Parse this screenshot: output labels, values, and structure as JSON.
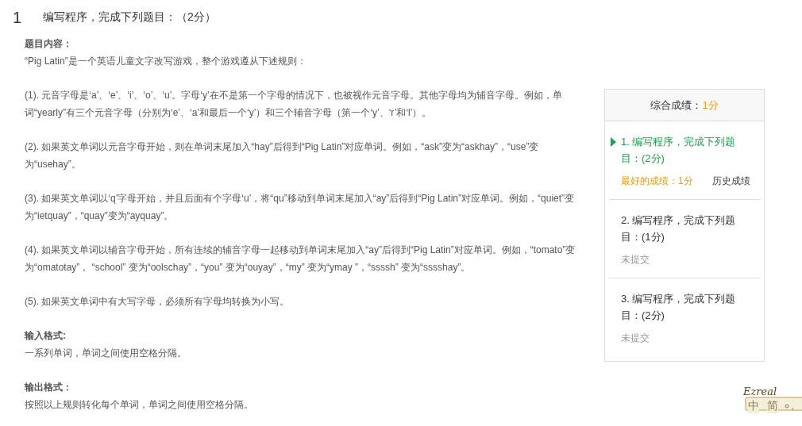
{
  "question": {
    "number": "1",
    "title": "编写程序，完成下列题目：（2分）"
  },
  "sections": [
    {
      "heading": "题目内容：",
      "paragraphs": [
        "“Pig Latin”是一个英语儿童文字改写游戏，整个游戏遵从下述规则：",
        "(1). 元音字母是‘a’、‘e’、‘i’、‘o’、‘u’。字母‘y’在不是第一个字母的情况下，也被视作元音字母。其他字母均为辅音字母。例如，单词“yearly”有三个元音字母（分别为‘e’、‘a’和最后一个‘y’）和三个辅音字母（第一个‘y’、‘r’和‘l’）。",
        "(2). 如果英文单词以元音字母开始，则在单词末尾加入“hay”后得到“Pig Latin”对应单词。例如，“ask”变为“askhay”，“use”变为“usehay”。",
        "(3). 如果英文单词以‘q’字母开始，并且后面有个字母‘u’，将“qu”移动到单词末尾加入“ay”后得到“Pig Latin”对应单词。例如，“quiet”变为“ietquay”，“quay”变为“ayquay”。",
        "(4). 如果英文单词以辅音字母开始，所有连续的辅音字母一起移动到单词末尾加入“ay”后得到“Pig Latin”对应单词。例如，“tomato”变为“omatotay”， “school” 变为“oolschay”，“you” 变为“ouyay”，“my” 变为“ymay ”，“ssssh” 变为“sssshay”。",
        "(5). 如果英文单词中有大写字母，必须所有字母均转换为小写。"
      ]
    },
    {
      "heading": "输入格式:",
      "paragraphs": [
        "一系列单词，单词之间使用空格分隔。"
      ]
    },
    {
      "heading": "输出格式：",
      "paragraphs": [
        "按照以上规则转化每个单词，单词之间使用空格分隔。"
      ]
    }
  ],
  "sidebar": {
    "total_label": "综合成绩：",
    "total_score": "1分",
    "items": [
      {
        "title": "1. 编写程序，完成下列题目：(2分)",
        "selected": true,
        "kind": "scored",
        "best_label": "最好的成绩：",
        "best_score": "1分",
        "history_link": "历史成绩"
      },
      {
        "title": "2. 编写程序，完成下列题目：(1分)",
        "selected": false,
        "kind": "unsubmitted",
        "status": "未提交"
      },
      {
        "title": "3. 编写程序，完成下列题目：(2分)",
        "selected": false,
        "kind": "unsubmitted",
        "status": "未提交"
      }
    ]
  },
  "ime_toolbar": {
    "logo": "Ezreal",
    "mode": "中",
    "charset": "简"
  }
}
